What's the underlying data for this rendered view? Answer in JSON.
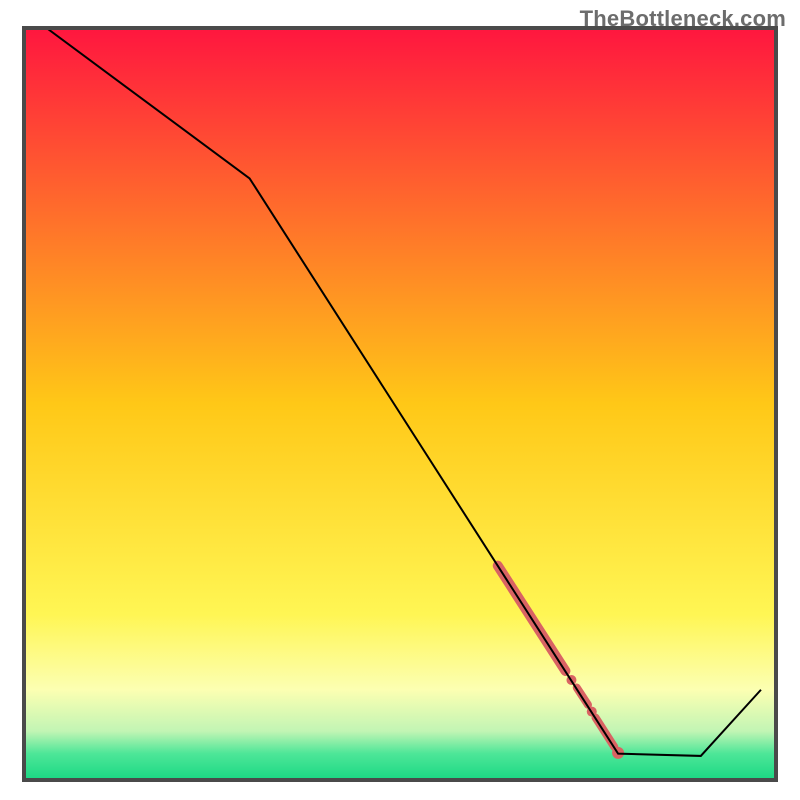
{
  "watermark": "TheBottleneck.com",
  "chart_data": {
    "type": "line",
    "title": "",
    "xlabel": "",
    "ylabel": "",
    "xlim": [
      0,
      100
    ],
    "ylim": [
      0,
      100
    ],
    "background_gradient": [
      {
        "offset": 0.0,
        "color": "#ff163f"
      },
      {
        "offset": 0.5,
        "color": "#ffc817"
      },
      {
        "offset": 0.78,
        "color": "#fff654"
      },
      {
        "offset": 0.88,
        "color": "#fcffb2"
      },
      {
        "offset": 0.935,
        "color": "#c2f5b4"
      },
      {
        "offset": 0.965,
        "color": "#4de698"
      },
      {
        "offset": 1.0,
        "color": "#19d883"
      }
    ],
    "curve_points": [
      {
        "x": 3.0,
        "y": 100.0
      },
      {
        "x": 30.0,
        "y": 80.0
      },
      {
        "x": 79.0,
        "y": 3.5
      },
      {
        "x": 90.0,
        "y": 3.2
      },
      {
        "x": 98.0,
        "y": 12.0
      }
    ],
    "highlight_segments": [
      {
        "x1": 63.0,
        "y1": 28.5,
        "x2": 72.0,
        "y2": 14.5,
        "width": 10
      },
      {
        "x1": 73.5,
        "y1": 12.3,
        "x2": 75.0,
        "y2": 10.0,
        "width": 8
      },
      {
        "x1": 76.0,
        "y1": 8.3,
        "x2": 78.5,
        "y2": 4.4,
        "width": 8
      }
    ],
    "highlight_dots": [
      {
        "x": 72.8,
        "y": 13.3,
        "r": 5
      },
      {
        "x": 75.5,
        "y": 9.1,
        "r": 5
      },
      {
        "x": 79.0,
        "y": 3.6,
        "r": 6
      }
    ],
    "highlight_color": "#d96363",
    "curve_color": "#000000",
    "frame_color": "#4a4a4a"
  }
}
